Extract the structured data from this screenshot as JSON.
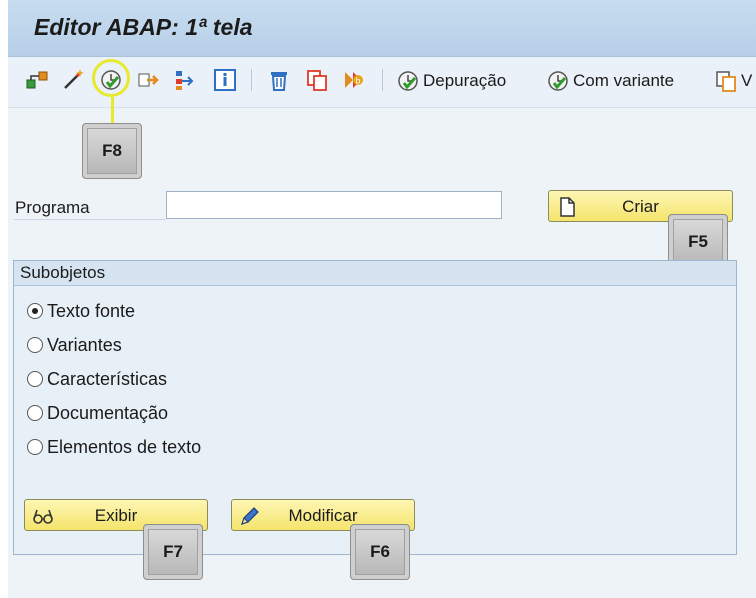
{
  "header": {
    "title": "Editor ABAP: 1ª tela"
  },
  "toolbar": {
    "icons": [
      "object-tree-icon",
      "wizard-icon",
      "execute-icon",
      "where-used-icon",
      "hierarchy-icon",
      "info-icon",
      "delete-icon",
      "copy-icon",
      "rename-icon"
    ],
    "debug_label": "Depuração",
    "variant_label": "Com variante",
    "truncated_label": "V"
  },
  "hotkeys": {
    "execute": "F8",
    "create": "F5",
    "display": "F7",
    "modify": "F6"
  },
  "program": {
    "label": "Programa",
    "value": ""
  },
  "create_button": {
    "label": "Criar"
  },
  "subobjects": {
    "title": "Subobjetos",
    "options": [
      {
        "label": "Texto fonte",
        "checked": true
      },
      {
        "label": "Variantes",
        "checked": false
      },
      {
        "label": "Características",
        "checked": false
      },
      {
        "label": "Documentação",
        "checked": false
      },
      {
        "label": "Elementos de texto",
        "checked": false
      }
    ]
  },
  "display_button": {
    "label": "Exibir"
  },
  "modify_button": {
    "label": "Modificar"
  },
  "colors": {
    "highlight": "#e7e92b",
    "button": "#f5e46c",
    "titlebar": "#c7dcef"
  }
}
